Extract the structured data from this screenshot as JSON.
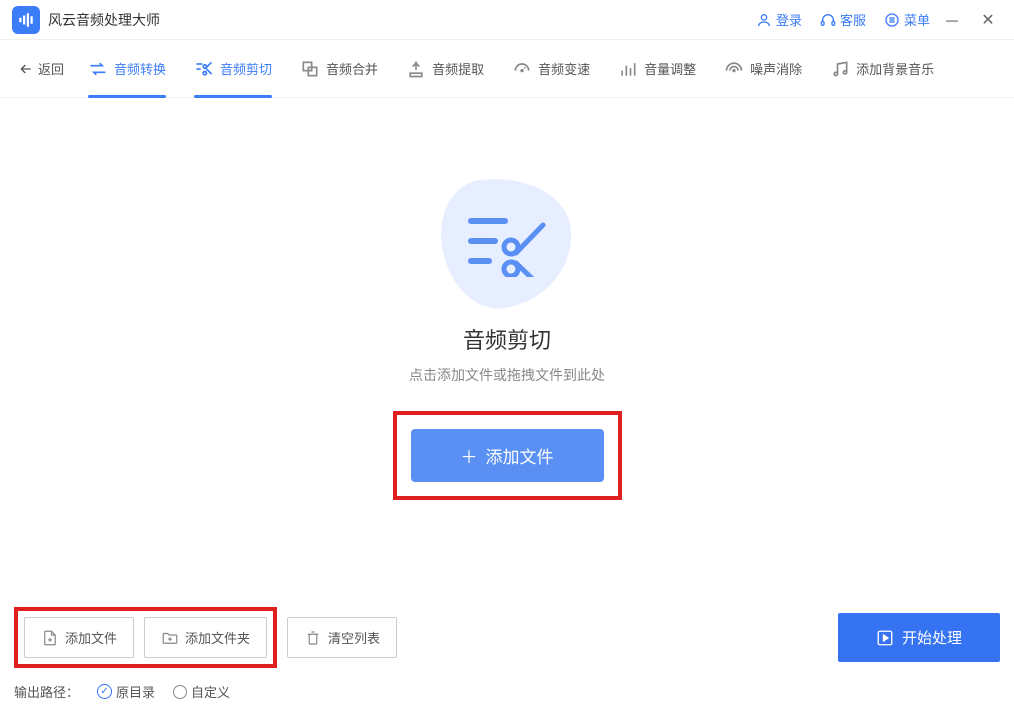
{
  "app": {
    "title": "风云音频处理大师"
  },
  "titlebar": {
    "login": "登录",
    "support": "客服",
    "menu": "菜单"
  },
  "toolbar": {
    "back": "返回",
    "tabs": [
      {
        "label": "音频转换",
        "active": true
      },
      {
        "label": "音频剪切",
        "active": true
      },
      {
        "label": "音频合并",
        "active": false
      },
      {
        "label": "音频提取",
        "active": false
      },
      {
        "label": "音频变速",
        "active": false
      },
      {
        "label": "音量调整",
        "active": false
      },
      {
        "label": "噪声消除",
        "active": false
      },
      {
        "label": "添加背景音乐",
        "active": false
      }
    ]
  },
  "drop": {
    "title": "音频剪切",
    "subtitle": "点击添加文件或拖拽文件到此处",
    "add_button": "添加文件"
  },
  "footer": {
    "add_file": "添加文件",
    "add_folder": "添加文件夹",
    "clear": "清空列表",
    "start": "开始处理",
    "output_label": "输出路径：",
    "opt_original": "原目录",
    "opt_custom": "自定义"
  },
  "colors": {
    "accent": "#3B7DF6",
    "highlight": "#E01F1F"
  }
}
